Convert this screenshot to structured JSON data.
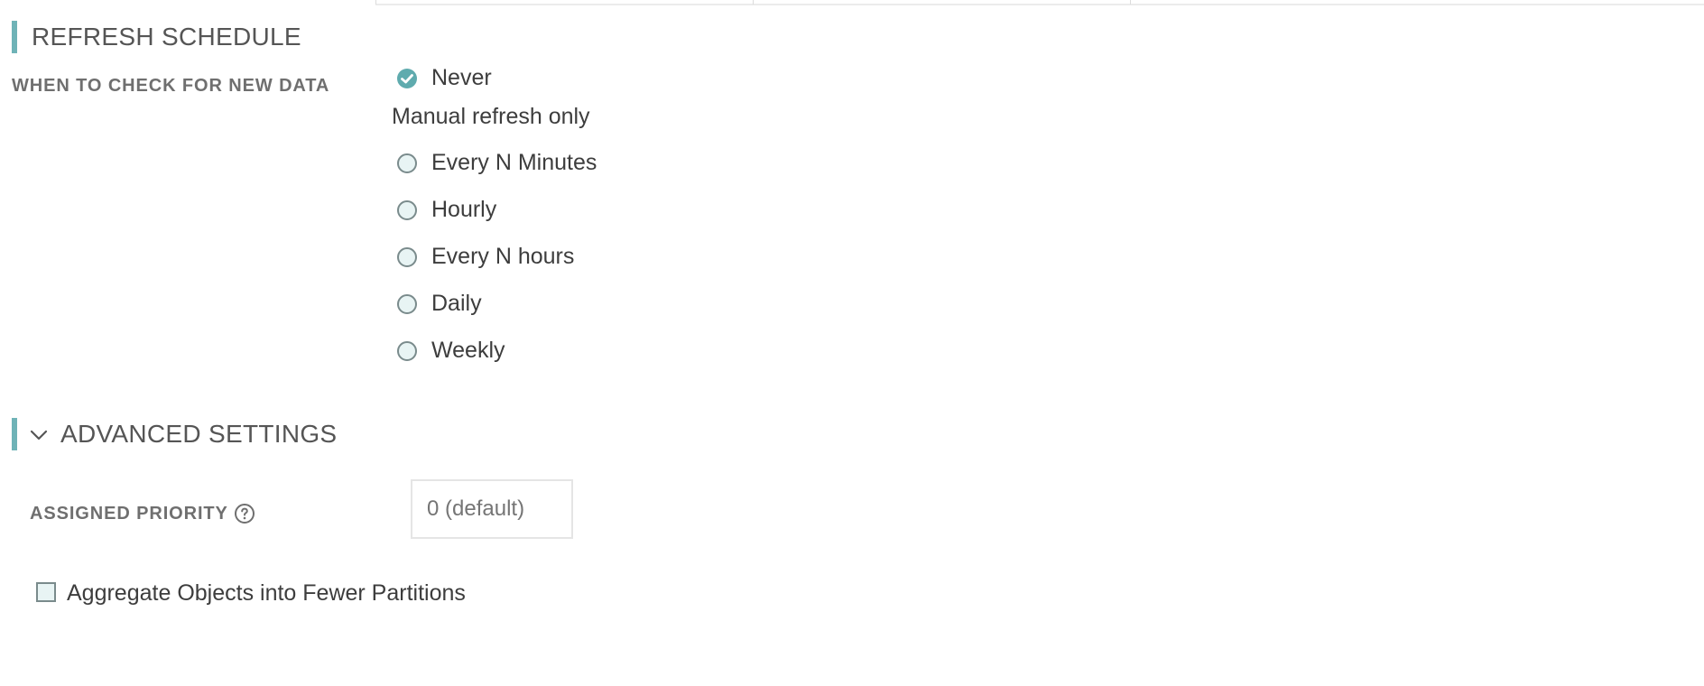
{
  "refresh_schedule": {
    "title": "REFRESH SCHEDULE",
    "when_label": "WHEN TO CHECK FOR NEW DATA",
    "options": [
      {
        "label": "Never",
        "checked": true
      },
      {
        "label": "Every N Minutes",
        "checked": false
      },
      {
        "label": "Hourly",
        "checked": false
      },
      {
        "label": "Every N hours",
        "checked": false
      },
      {
        "label": "Daily",
        "checked": false
      },
      {
        "label": "Weekly",
        "checked": false
      }
    ],
    "selected_description": "Manual refresh only"
  },
  "advanced_settings": {
    "title": "ADVANCED SETTINGS",
    "expanded": true,
    "priority_label": "ASSIGNED PRIORITY",
    "priority_placeholder": "0 (default)",
    "priority_value": "",
    "aggregate_label": "Aggregate Objects into Fewer Partitions",
    "aggregate_checked": false
  },
  "colors": {
    "accent": "#6fb3b7",
    "radio_checked": "#5fabae",
    "radio_unchecked_fill": "#e8f4f4",
    "label_gray": "#6f6f6f"
  },
  "icons": {
    "checked_radio": "check-circle-icon",
    "collapse": "chevron-down-icon",
    "help": "question-circle-icon"
  }
}
